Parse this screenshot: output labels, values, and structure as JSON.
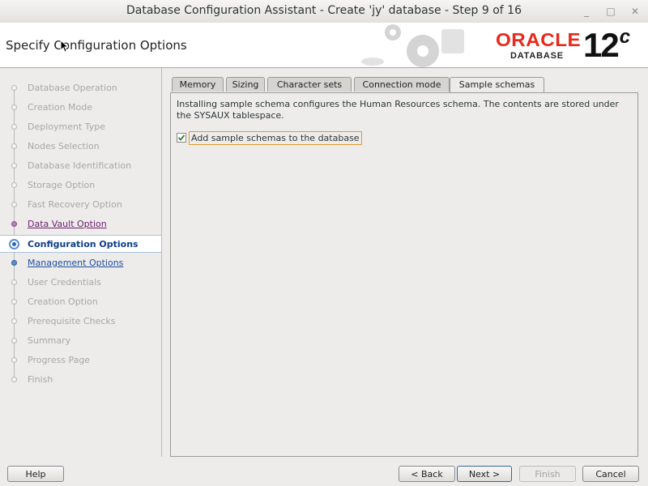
{
  "window": {
    "title": "Database Configuration Assistant - Create 'jy' database - Step 9 of 16"
  },
  "header": {
    "page_title": "Specify Configuration Options",
    "brand": "ORACLE",
    "product": "DATABASE",
    "version": "12",
    "version_suffix": "c"
  },
  "nav": {
    "items": [
      {
        "label": "Database Operation",
        "state": "disabled"
      },
      {
        "label": "Creation Mode",
        "state": "disabled"
      },
      {
        "label": "Deployment Type",
        "state": "disabled"
      },
      {
        "label": "Nodes Selection",
        "state": "disabled"
      },
      {
        "label": "Database Identification",
        "state": "disabled"
      },
      {
        "label": "Storage Option",
        "state": "disabled"
      },
      {
        "label": "Fast Recovery Option",
        "state": "disabled"
      },
      {
        "label": "Data Vault Option",
        "state": "visited"
      },
      {
        "label": "Configuration Options",
        "state": "current"
      },
      {
        "label": "Management Options",
        "state": "link"
      },
      {
        "label": "User Credentials",
        "state": "disabled"
      },
      {
        "label": "Creation Option",
        "state": "disabled"
      },
      {
        "label": "Prerequisite Checks",
        "state": "disabled"
      },
      {
        "label": "Summary",
        "state": "disabled"
      },
      {
        "label": "Progress Page",
        "state": "disabled"
      },
      {
        "label": "Finish",
        "state": "disabled"
      }
    ]
  },
  "tabs": [
    {
      "label": "Memory",
      "active": false
    },
    {
      "label": "Sizing",
      "active": false
    },
    {
      "label": "Character sets",
      "active": false
    },
    {
      "label": "Connection mode",
      "active": false
    },
    {
      "label": "Sample schemas",
      "active": true
    }
  ],
  "panel": {
    "description": "Installing sample schema configures the Human Resources schema. The contents are stored under the SYSAUX tablespace.",
    "checkbox_label": "Add sample schemas to the database",
    "checkbox_checked": true
  },
  "buttons": {
    "help": "Help",
    "back": "< Back",
    "next": "Next >",
    "finish": "Finish",
    "cancel": "Cancel"
  },
  "colors": {
    "brand_red": "#e8291c",
    "visited_link": "#6c1e6c",
    "link": "#1f4fa0",
    "focus": "#e09a2a"
  }
}
